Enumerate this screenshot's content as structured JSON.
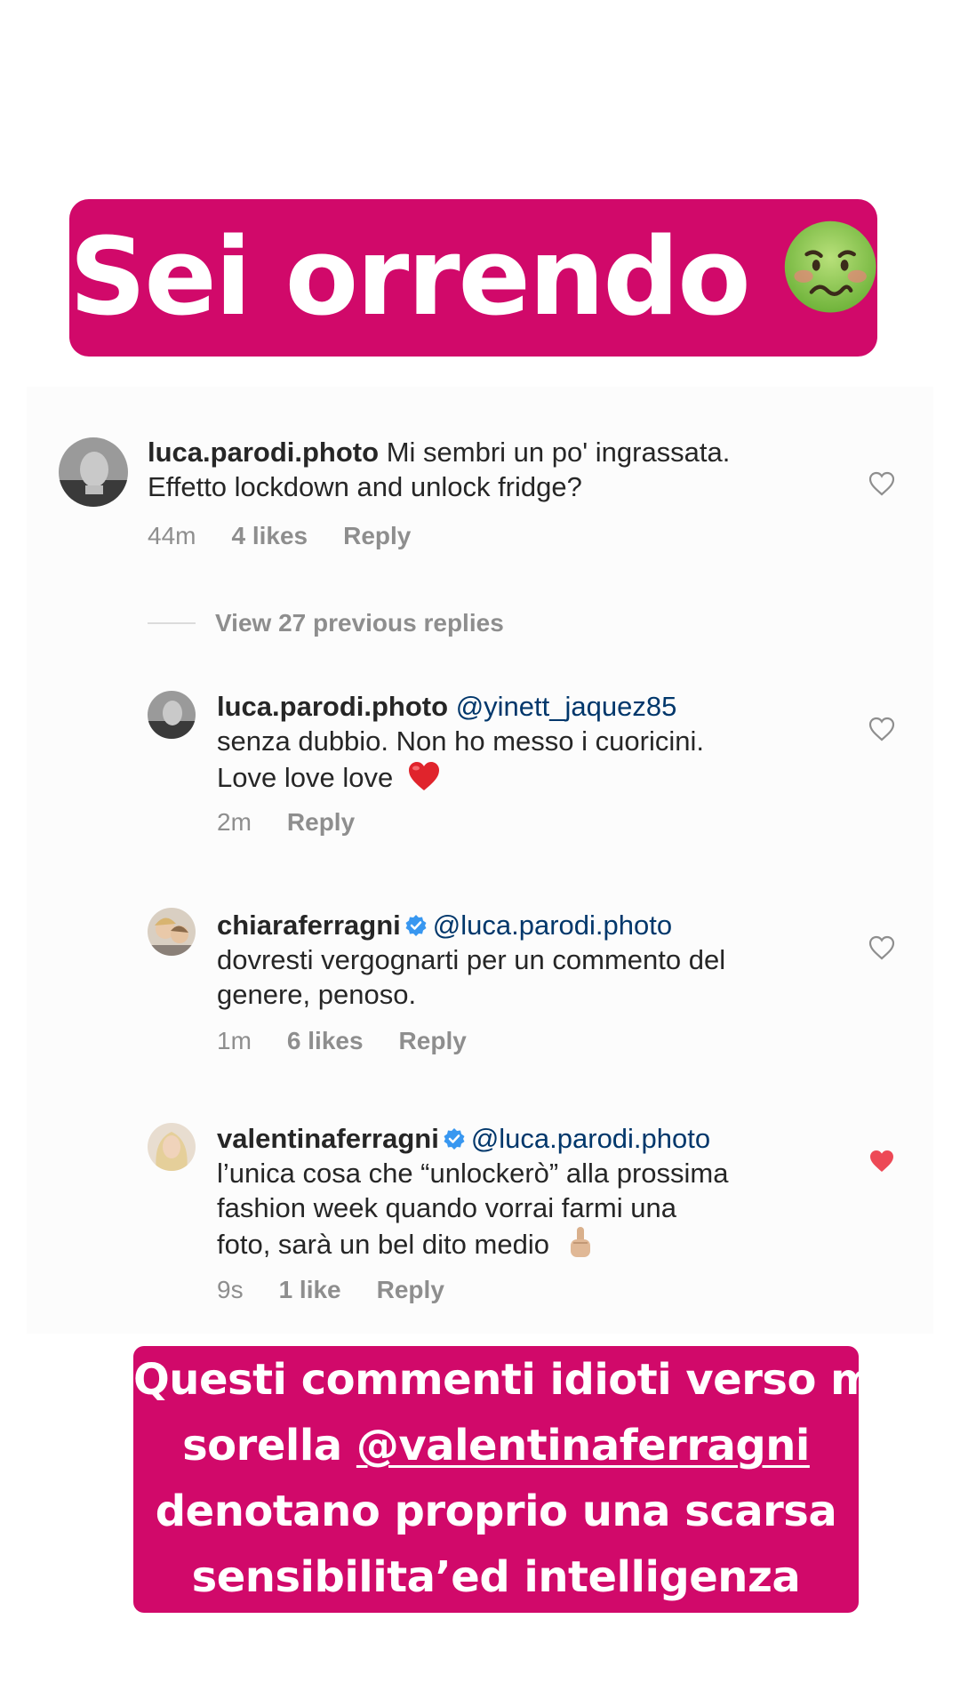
{
  "title": {
    "text": "Sei orrendo",
    "emoji": "nauseated-face-emoji",
    "bg_color": "#d1096a"
  },
  "comments": [
    {
      "username": "luca.parodi.photo",
      "mention": "",
      "text_line1": "Mi sembri un po' ingrassata.",
      "text_line2": "Effetto lockdown and unlock fridge?",
      "time": "44m",
      "likes": "4 likes",
      "reply": "Reply",
      "liked": false
    },
    {
      "username": "luca.parodi.photo",
      "mention": "@yinett_jaquez85",
      "text_line1": "senza dubbio. Non ho messo i cuoricini.",
      "text_line2": "Love love love",
      "emoji": "red-heart-emoji",
      "time": "2m",
      "likes": "",
      "reply": "Reply",
      "liked": false
    },
    {
      "username": "chiaraferragni",
      "verified": true,
      "mention": "@luca.parodi.photo",
      "text_line1": "dovresti vergognarti per un commento del",
      "text_line2": "genere, penoso.",
      "time": "1m",
      "likes": "6 likes",
      "reply": "Reply",
      "liked": false
    },
    {
      "username": "valentinaferragni",
      "verified": true,
      "mention": "@luca.parodi.photo",
      "text_line1": "l’unica cosa che “unlockerò” alla prossima",
      "text_line2": "fashion week quando vorrai farmi una",
      "text_line3": "foto, sarà un bel dito medio",
      "emoji": "middle-finger-emoji",
      "time": "9s",
      "likes": "1 like",
      "reply": "Reply",
      "liked": true
    }
  ],
  "view_replies": "View 27 previous replies",
  "bottom_caption": {
    "line1": "Questi commenti idioti verso mia",
    "line2_prefix": "sorella ",
    "line2_mention": "@valentinaferragni",
    "line3": "denotano proprio una scarsa",
    "line4": "sensibilita’ed intelligenza",
    "bg_color": "#d1096a"
  },
  "colors": {
    "like_red": "#ed4956",
    "mention_blue": "#00376b",
    "muted": "#8e8e8e",
    "verified_blue": "#3897f0"
  }
}
